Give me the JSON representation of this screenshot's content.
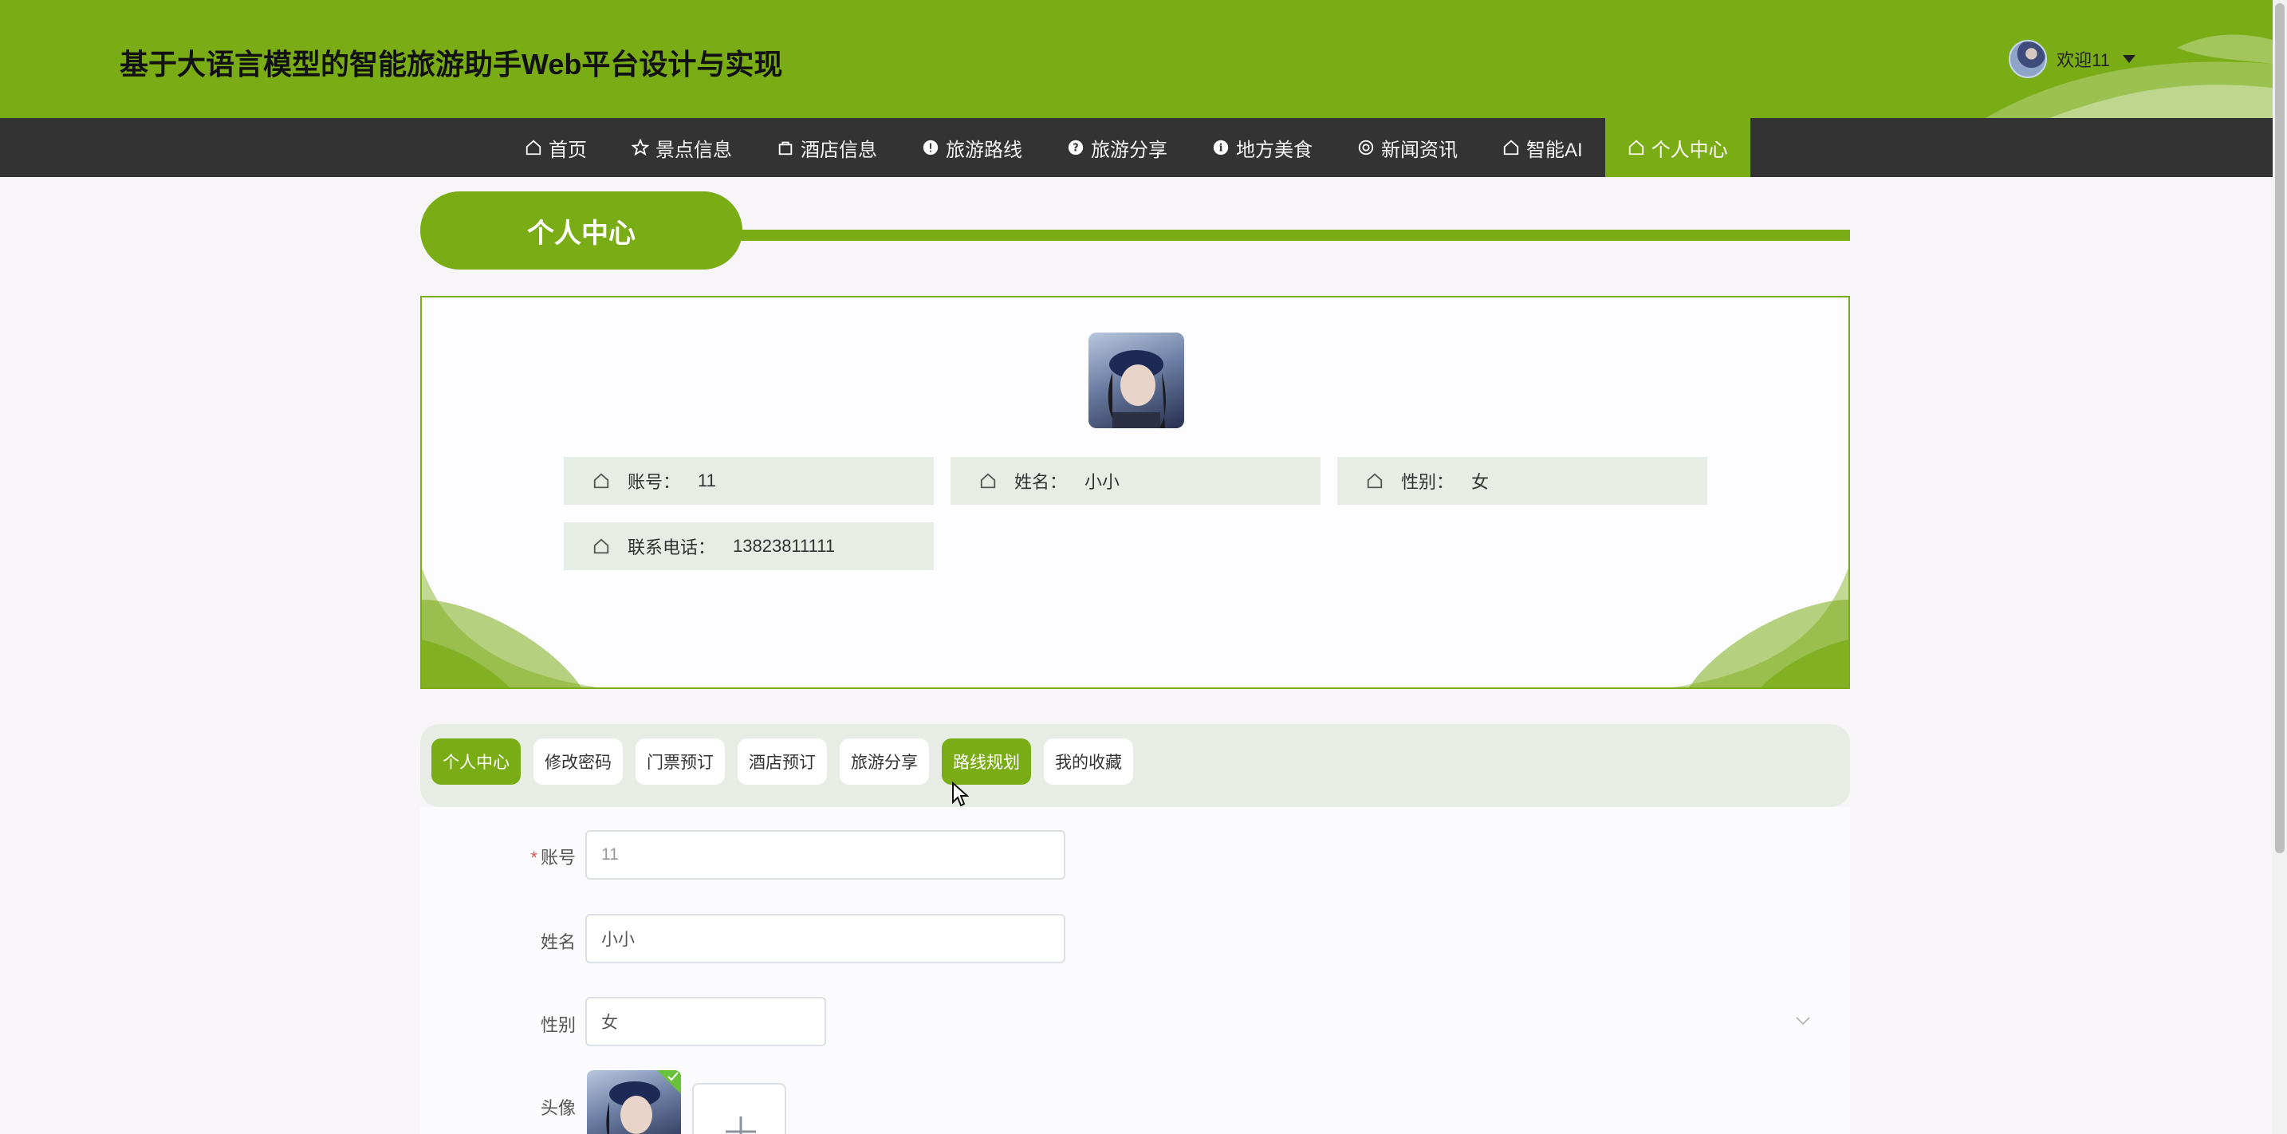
{
  "header": {
    "title": "基于大语言模型的智能旅游助手Web平台设计与实现",
    "user_greeting": "欢迎11",
    "brand_color": "#7aac16"
  },
  "nav": {
    "items": [
      {
        "label": "首页",
        "icon": "home-icon"
      },
      {
        "label": "景点信息",
        "icon": "star-icon"
      },
      {
        "label": "酒店信息",
        "icon": "bag-icon"
      },
      {
        "label": "旅游路线",
        "icon": "alert-icon"
      },
      {
        "label": "旅游分享",
        "icon": "help-icon"
      },
      {
        "label": "地方美食",
        "icon": "info-icon"
      },
      {
        "label": "新闻资讯",
        "icon": "at-icon"
      },
      {
        "label": "智能AI",
        "icon": "home-icon"
      },
      {
        "label": "个人中心",
        "icon": "home-icon",
        "active": true
      }
    ]
  },
  "section": {
    "title": "个人中心"
  },
  "profile": {
    "account_label": "账号：",
    "account_value": "11",
    "name_label": "姓名：",
    "name_value": "小小",
    "gender_label": "性别：",
    "gender_value": "女",
    "phone_label": "联系电话：",
    "phone_value": "13823811111"
  },
  "tabs": [
    {
      "label": "个人中心",
      "active": true
    },
    {
      "label": "修改密码",
      "active": false
    },
    {
      "label": "门票预订",
      "active": false
    },
    {
      "label": "酒店预订",
      "active": false
    },
    {
      "label": "旅游分享",
      "active": false
    },
    {
      "label": "路线规划",
      "active": true
    },
    {
      "label": "我的收藏",
      "active": false
    }
  ],
  "form": {
    "account_label": "账号",
    "account_value": "11",
    "name_label": "姓名",
    "name_value": "小小",
    "gender_label": "性别",
    "gender_value": "女",
    "avatar_label": "头像"
  }
}
